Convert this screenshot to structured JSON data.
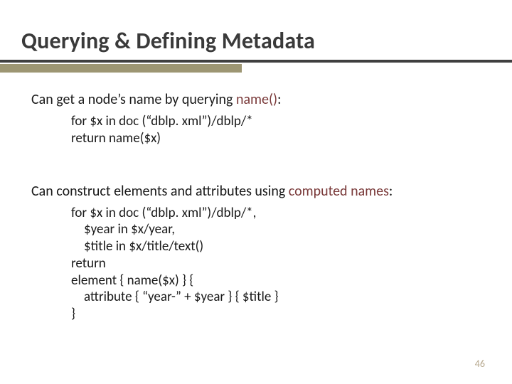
{
  "title": "Querying & Defining Metadata",
  "section1": {
    "lead_pre": "Can get a node’s name by querying ",
    "lead_fn": "name()",
    "lead_post": ":",
    "code": {
      "l1": "for $x in doc (“dblp. xml”)/dblp/*",
      "l2": "return name($x)"
    }
  },
  "section2": {
    "lead_pre": "Can construct elements and attributes using ",
    "lead_fn": "computed names",
    "lead_post": ":",
    "code": {
      "l1": "for $x in doc (“dblp. xml”)/dblp/*,",
      "l2": "$year in $x/year,",
      "l3": "$title in $x/title/text()",
      "l4": "return",
      "l5": "element { name($x) } {",
      "l6": "attribute { “year-” + $year } { $title }",
      "l7": "}"
    }
  },
  "page_number": "46"
}
